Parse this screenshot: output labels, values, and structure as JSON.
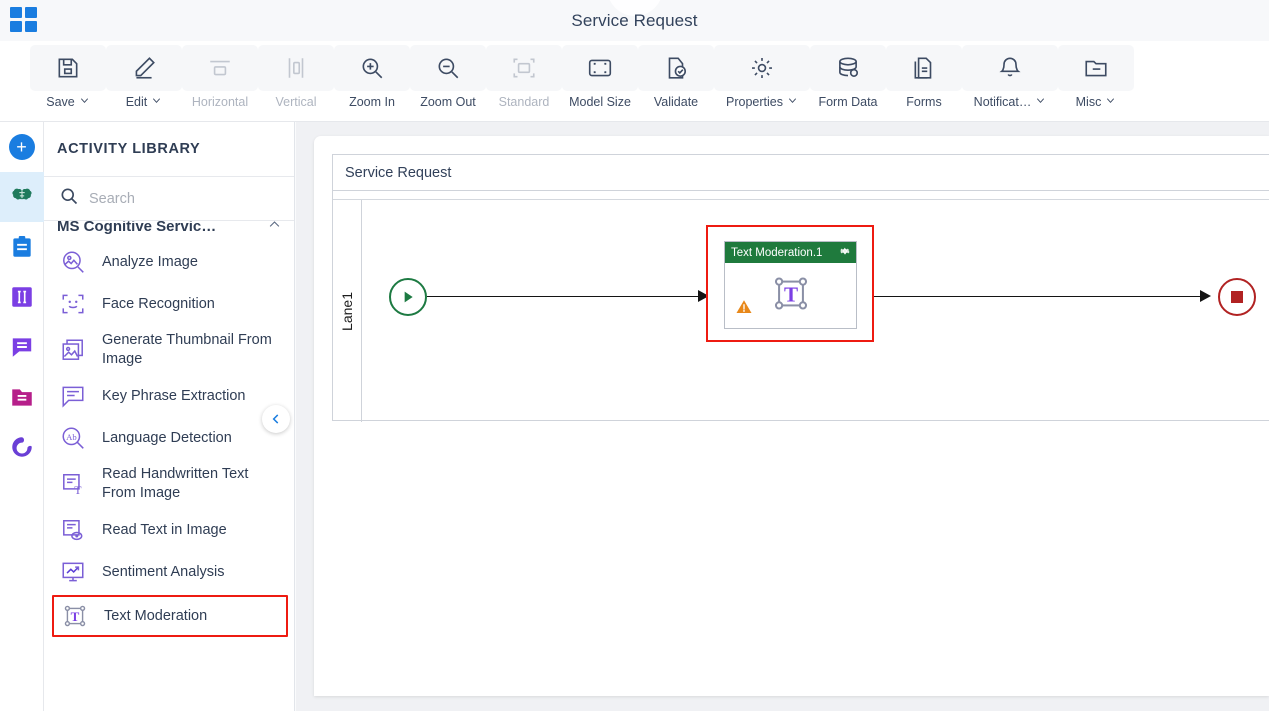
{
  "titlebar": {
    "app_title": "Service Request",
    "apps_icon": "apps-grid-icon"
  },
  "toolbar": {
    "buttons": [
      {
        "label": "Save",
        "icon": "save-icon",
        "caret": true,
        "disabled": false
      },
      {
        "label": "Edit",
        "icon": "pencil-icon",
        "caret": true,
        "disabled": false
      },
      {
        "label": "Horizontal",
        "icon": "horizontal-icon",
        "caret": false,
        "disabled": true
      },
      {
        "label": "Vertical",
        "icon": "vertical-icon",
        "caret": false,
        "disabled": true
      },
      {
        "label": "Zoom In",
        "icon": "zoom-in-icon",
        "caret": false,
        "disabled": false
      },
      {
        "label": "Zoom Out",
        "icon": "zoom-out-icon",
        "caret": false,
        "disabled": false
      },
      {
        "label": "Standard",
        "icon": "standard-icon",
        "caret": false,
        "disabled": true
      },
      {
        "label": "Model Size",
        "icon": "model-size-icon",
        "caret": false,
        "disabled": false
      },
      {
        "label": "Validate",
        "icon": "validate-icon",
        "caret": false,
        "disabled": false
      },
      {
        "label": "Properties",
        "icon": "gear-icon",
        "caret": true,
        "disabled": false
      },
      {
        "label": "Form Data",
        "icon": "database-icon",
        "caret": false,
        "disabled": false
      },
      {
        "label": "Forms",
        "icon": "document-icon",
        "caret": false,
        "disabled": false
      },
      {
        "label": "Notificat…",
        "icon": "bell-icon",
        "caret": true,
        "disabled": false
      },
      {
        "label": "Misc",
        "icon": "folder-icon",
        "caret": true,
        "disabled": false
      }
    ]
  },
  "rail": {
    "items": [
      {
        "name": "add-button",
        "icon": "plus-icon",
        "color": "#1a7de0",
        "selected": false
      },
      {
        "name": "cognitive-section",
        "icon": "brain-icon",
        "color": "#1f7a5c",
        "selected": true
      },
      {
        "name": "forms-section",
        "icon": "clipboard-icon",
        "color": "#1a7de0",
        "selected": false
      },
      {
        "name": "data-section",
        "icon": "columns-icon",
        "color": "#7b3fe4",
        "selected": false
      },
      {
        "name": "messages-section",
        "icon": "chat-icon",
        "color": "#7b3fe4",
        "selected": false
      },
      {
        "name": "files-section",
        "icon": "folder-icon",
        "color": "#b61f8a",
        "selected": false
      },
      {
        "name": "app-logo",
        "icon": "swirl-icon",
        "color": "#6a3fd6",
        "selected": false
      }
    ]
  },
  "panel": {
    "header": "ACTIVITY LIBRARY",
    "search_placeholder": "Search",
    "search_value": "",
    "category": "MS Cognitive Servic…",
    "category_state": "expanded",
    "collapse_button": "collapse-panel-button",
    "activities": [
      {
        "label": "Analyze Image",
        "icon": "analyze-image-icon",
        "highlighted": false
      },
      {
        "label": "Face Recognition",
        "icon": "face-icon",
        "highlighted": false
      },
      {
        "label": "Generate Thumbnail From Image",
        "icon": "thumbnail-icon",
        "highlighted": false
      },
      {
        "label": "Key Phrase Extraction",
        "icon": "key-phrase-icon",
        "highlighted": false
      },
      {
        "label": "Language Detection",
        "icon": "language-icon",
        "highlighted": false
      },
      {
        "label": "Read Handwritten Text From Image",
        "icon": "handwritten-icon",
        "highlighted": false
      },
      {
        "label": "Read Text in Image",
        "icon": "read-text-icon",
        "highlighted": false
      },
      {
        "label": "Sentiment Analysis",
        "icon": "sentiment-icon",
        "highlighted": false
      },
      {
        "label": "Text Moderation",
        "icon": "text-moderation-icon",
        "highlighted": true
      }
    ]
  },
  "canvas": {
    "pool_title": "Service Request",
    "lane_label": "Lane1",
    "start_event": "start-event",
    "end_event": "end-event",
    "node": {
      "title": "Text Moderation.1",
      "header_color": "#1f7a3d",
      "selection_color": "#ee1b11",
      "gear": "gear-icon",
      "warning": "warning-icon",
      "glyph": "text-moderation-icon"
    }
  }
}
